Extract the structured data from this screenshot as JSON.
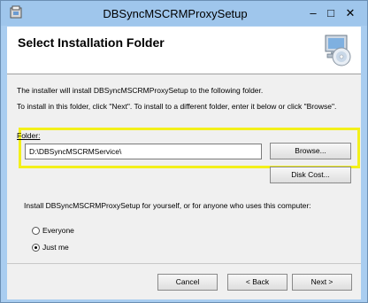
{
  "window": {
    "title": "DBSyncMSCRMProxySetup",
    "controls": {
      "minimize": "–",
      "maximize": "□",
      "close": "✕"
    }
  },
  "header": {
    "title": "Select Installation Folder",
    "icon": "computer-cd-icon"
  },
  "body": {
    "line1": "The installer will install DBSyncMSCRMProxySetup to the following folder.",
    "line2": "To install in this folder, click \"Next\". To install to a different folder, enter it below or click \"Browse\".",
    "folder_label": "Folder:",
    "folder_value": "D:\\DBSyncMSCRMService\\",
    "browse_label": "Browse...",
    "disk_cost_label": "Disk Cost...",
    "install_for_text": "Install DBSyncMSCRMProxySetup for yourself, or for anyone who uses this computer:",
    "options": [
      {
        "label": "Everyone",
        "selected": false
      },
      {
        "label": "Just me",
        "selected": true
      }
    ],
    "highlight_color": "#f3f01b"
  },
  "footer": {
    "cancel_label": "Cancel",
    "back_label": "< Back",
    "next_label": "Next >"
  }
}
